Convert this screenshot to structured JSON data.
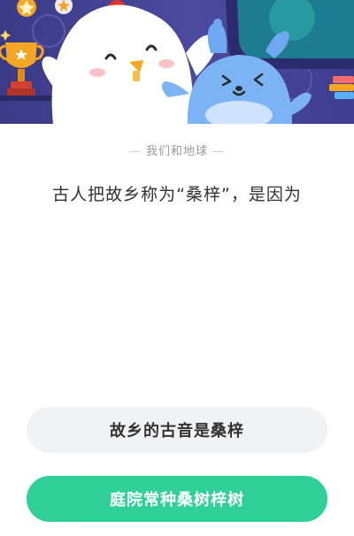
{
  "banner": {
    "mascots": [
      "chicken-mascot",
      "blue-bunny-mascot"
    ],
    "decorations": [
      "trophy-icon",
      "star-medal-icon",
      "books-icon"
    ]
  },
  "quiz": {
    "category": "我们和地球",
    "question": "古人把故乡称为“桑梓”，是因为",
    "options": [
      {
        "label": "故乡的古音是桑梓",
        "state": "default"
      },
      {
        "label": "庭院常种桑树梓树",
        "state": "highlighted"
      }
    ]
  },
  "colors": {
    "banner_bg": "#3b3a86",
    "option_default_bg": "#f1f2f4",
    "option_highlight_bg": "#2fd197",
    "question_text": "#333333",
    "category_text": "#9a9a9a"
  }
}
